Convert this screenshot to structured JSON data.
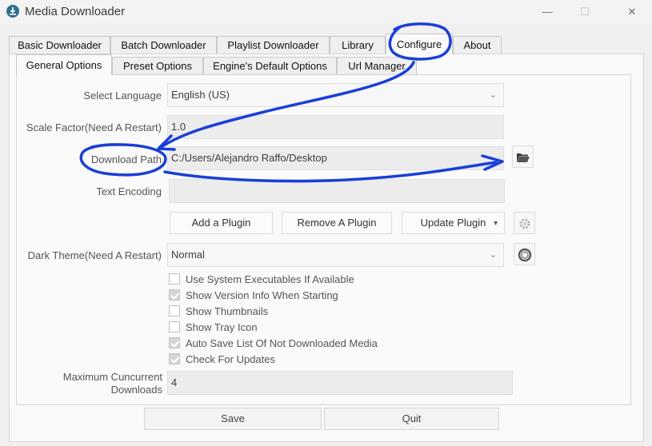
{
  "window": {
    "title": "Media Downloader",
    "controls": {
      "minimize": "—",
      "maximize": "☐",
      "close": "✕"
    }
  },
  "outer_tabs": [
    {
      "label": "Basic Downloader"
    },
    {
      "label": "Batch Downloader"
    },
    {
      "label": "Playlist Downloader"
    },
    {
      "label": "Library"
    },
    {
      "label": "Configure",
      "active": true
    },
    {
      "label": "About"
    }
  ],
  "inner_tabs": [
    {
      "label": "General Options",
      "active": true
    },
    {
      "label": "Preset Options"
    },
    {
      "label": "Engine's Default Options"
    },
    {
      "label": "Url Manager"
    }
  ],
  "form": {
    "language": {
      "label": "Select Language",
      "value": "English (US)"
    },
    "scale": {
      "label": "Scale Factor(Need A Restart)",
      "value": "1.0"
    },
    "download_path": {
      "label": "Download Path",
      "value": "C:/Users/Alejandro Raffo/Desktop"
    },
    "text_encoding": {
      "label": "Text Encoding",
      "value": ""
    },
    "plugins": {
      "add": "Add a Plugin",
      "remove": "Remove A Plugin",
      "update": "Update Plugin"
    },
    "dark_theme": {
      "label": "Dark Theme(Need A Restart)",
      "value": "Normal"
    },
    "checkboxes": [
      {
        "label": "Use System Executables If Available",
        "checked": false
      },
      {
        "label": "Show Version Info When Starting",
        "checked": true
      },
      {
        "label": "Show Thumbnails",
        "checked": false
      },
      {
        "label": "Show Tray Icon",
        "checked": false
      },
      {
        "label": "Auto Save List Of Not Downloaded Media",
        "checked": true
      },
      {
        "label": "Check For Updates",
        "checked": true
      }
    ],
    "max_concurrent": {
      "label_line1": "Maximum Cuncurrent",
      "label_line2": "Downloads",
      "value": "4"
    }
  },
  "footer": {
    "save": "Save",
    "quit": "Quit"
  },
  "icons": {
    "folder": "folder-open-icon",
    "gear": "gear-icon",
    "theme": "theme-ring-icon",
    "chevron": "chevron-down-icon"
  },
  "annotation_color": "#1a3fd6"
}
